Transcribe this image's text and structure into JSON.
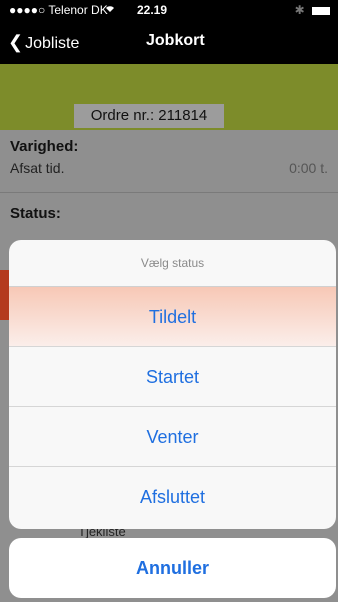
{
  "status_bar": {
    "carrier": "●●●●○ Telenor DK",
    "wifi": "wifi-icon",
    "time": "22.19",
    "bluetooth": "bluetooth-icon",
    "battery": "battery-icon"
  },
  "nav": {
    "back_label": "Jobliste",
    "title": "Jobkort"
  },
  "order": {
    "label": "Ordre nr.: 211814"
  },
  "sections": {
    "varighed_heading": "Varighed:",
    "afsat_label": "Afsat tid.",
    "afsat_value": "0:00 t.",
    "status_heading": "Status:",
    "partial_under_sheet": "Tjekliste"
  },
  "action_sheet": {
    "title": "Vælg status",
    "options": [
      "Tildelt",
      "Startet",
      "Venter",
      "Afsluttet"
    ],
    "cancel": "Annuller"
  }
}
